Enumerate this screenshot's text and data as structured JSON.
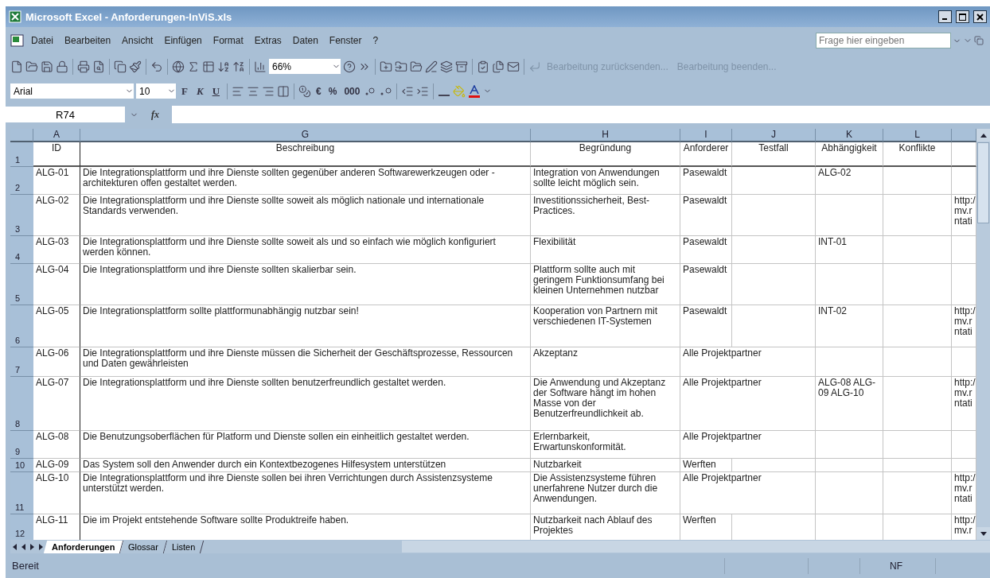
{
  "window": {
    "title": "Microsoft Excel - Anforderungen-InViS.xls"
  },
  "menu": [
    "Datei",
    "Bearbeiten",
    "Ansicht",
    "Einfügen",
    "Format",
    "Extras",
    "Daten",
    "Fenster",
    "?"
  ],
  "help_field": {
    "placeholder": "Frage hier eingeben"
  },
  "toolbar": {
    "zoom": "66%",
    "review_buttons": [
      "Bearbeitung zurücksenden...",
      "Bearbeitung beenden..."
    ]
  },
  "formatting_toolbar": {
    "font": "Arial",
    "size": "10",
    "style_buttons": [
      "F",
      "K",
      "U"
    ],
    "number_buttons": [
      "€",
      "%",
      "000"
    ]
  },
  "formula_bar": {
    "name_box": "R74",
    "fx": "fx"
  },
  "sheet": {
    "column_letters": [
      "A",
      "G",
      "H",
      "I",
      "J",
      "K",
      "L"
    ],
    "rows": [
      {
        "row": "1",
        "A": "ID",
        "G": "Beschreibung",
        "H": "Begründung",
        "I": "Anforderer",
        "J": "Testfall",
        "K": "Abhängigkeit",
        "L": "Konflikte"
      },
      {
        "row": "2",
        "A": "ALG-01",
        "G": "Die Integrationsplattform und ihre Dienste sollten gegenüber anderen Softwarewerkzeugen oder - architekturen offen gestaltet werden.",
        "H": "Integration von Anwendungen sollte leicht möglich sein.",
        "I": "Pasewaldt",
        "K": "ALG-02"
      },
      {
        "row": "3",
        "A": "ALG-02",
        "G": "Die Integrationsplattform und ihre Dienste sollte soweit als möglich nationale und internationale Standards verwenden.",
        "H": "Investitionssicherheit, Best-Practices.",
        "I": "Pasewaldt",
        "M": "http:/\nmv.r\nntati"
      },
      {
        "row": "4",
        "A": "ALG-03",
        "G": "Die Integrationsplattform und ihre Dienste sollte soweit als und so einfach wie möglich konfiguriert werden können.",
        "H": "Flexibilität",
        "I": "Pasewaldt",
        "K": "INT-01"
      },
      {
        "row": "5",
        "A": "ALG-04",
        "G": "Die Integrationsplattform und ihre Dienste sollten skalierbar sein.",
        "H": "Plattform sollte auch mit geringem Funktionsumfang bei kleinen Unternehmen nutzbar",
        "I": "Pasewaldt"
      },
      {
        "row": "6",
        "A": "ALG-05",
        "G": "Die Integrationsplattform sollte plattformunabhängig nutzbar sein!",
        "H": "Kooperation von Partnern mit verschiedenen IT-Systemen",
        "I": "Pasewaldt",
        "K": "INT-02",
        "M": "http:/\nmv.r\nntati"
      },
      {
        "row": "7",
        "A": "ALG-06",
        "G": "Die Integrationsplattform und ihre Dienste müssen die Sicherheit der Geschäftsprozesse, Ressourcen und Daten gewährleisten",
        "H": "Akzeptanz",
        "I": "Alle Projektpartner"
      },
      {
        "row": "8",
        "A": "ALG-07",
        "G": "Die Integrationsplattform und ihre Dienste sollten benutzerfreundlich gestaltet werden.",
        "H": "Die Anwendung und Akzeptanz der Software hängt im hohen Masse von der Benutzerfreundlichkeit ab.",
        "I": "Alle Projektpartner",
        "K": "ALG-08 ALG-09 ALG-10",
        "M": "http:/\nmv.r\nntati"
      },
      {
        "row": "9",
        "A": "ALG-08",
        "G": "Die Benutzungsoberflächen für Platform und Dienste sollen ein einheitlich gestaltet werden.",
        "H": "Erlernbarkeit, Erwartunskonformität.",
        "I": "Alle Projektpartner"
      },
      {
        "row": "10",
        "A": "ALG-09",
        "G": "Das System soll den Anwender durch ein Kontextbezogenes Hilfesystem unterstützen",
        "H": "Nutzbarkeit",
        "I": "Werften"
      },
      {
        "row": "11",
        "A": "ALG-10",
        "G": "Die Integrationsplattform und ihre Dienste sollen bei ihren Verrichtungen durch Assistenzsysteme unterstützt werden.",
        "H": "Die Assistenzsysteme führen unerfahrene Nutzer durch die Anwendungen.",
        "I": "Alle Projektpartner",
        "M": "http:/\nmv.r\nntati"
      },
      {
        "row": "12",
        "A": "ALG-11",
        "G": "Die im Projekt entstehende Software sollte Produktreife haben.",
        "H": "Nutzbarkeit nach Ablauf des Projektes",
        "I": "Werften",
        "M": "http:/\nmv.r"
      }
    ]
  },
  "sheet_tabs": [
    {
      "label": "Anforderungen",
      "selected": true
    },
    {
      "label": "Glossar",
      "selected": false
    },
    {
      "label": "Listen",
      "selected": false
    }
  ],
  "status_bar": {
    "text": "Bereit",
    "indicator": "NF"
  }
}
